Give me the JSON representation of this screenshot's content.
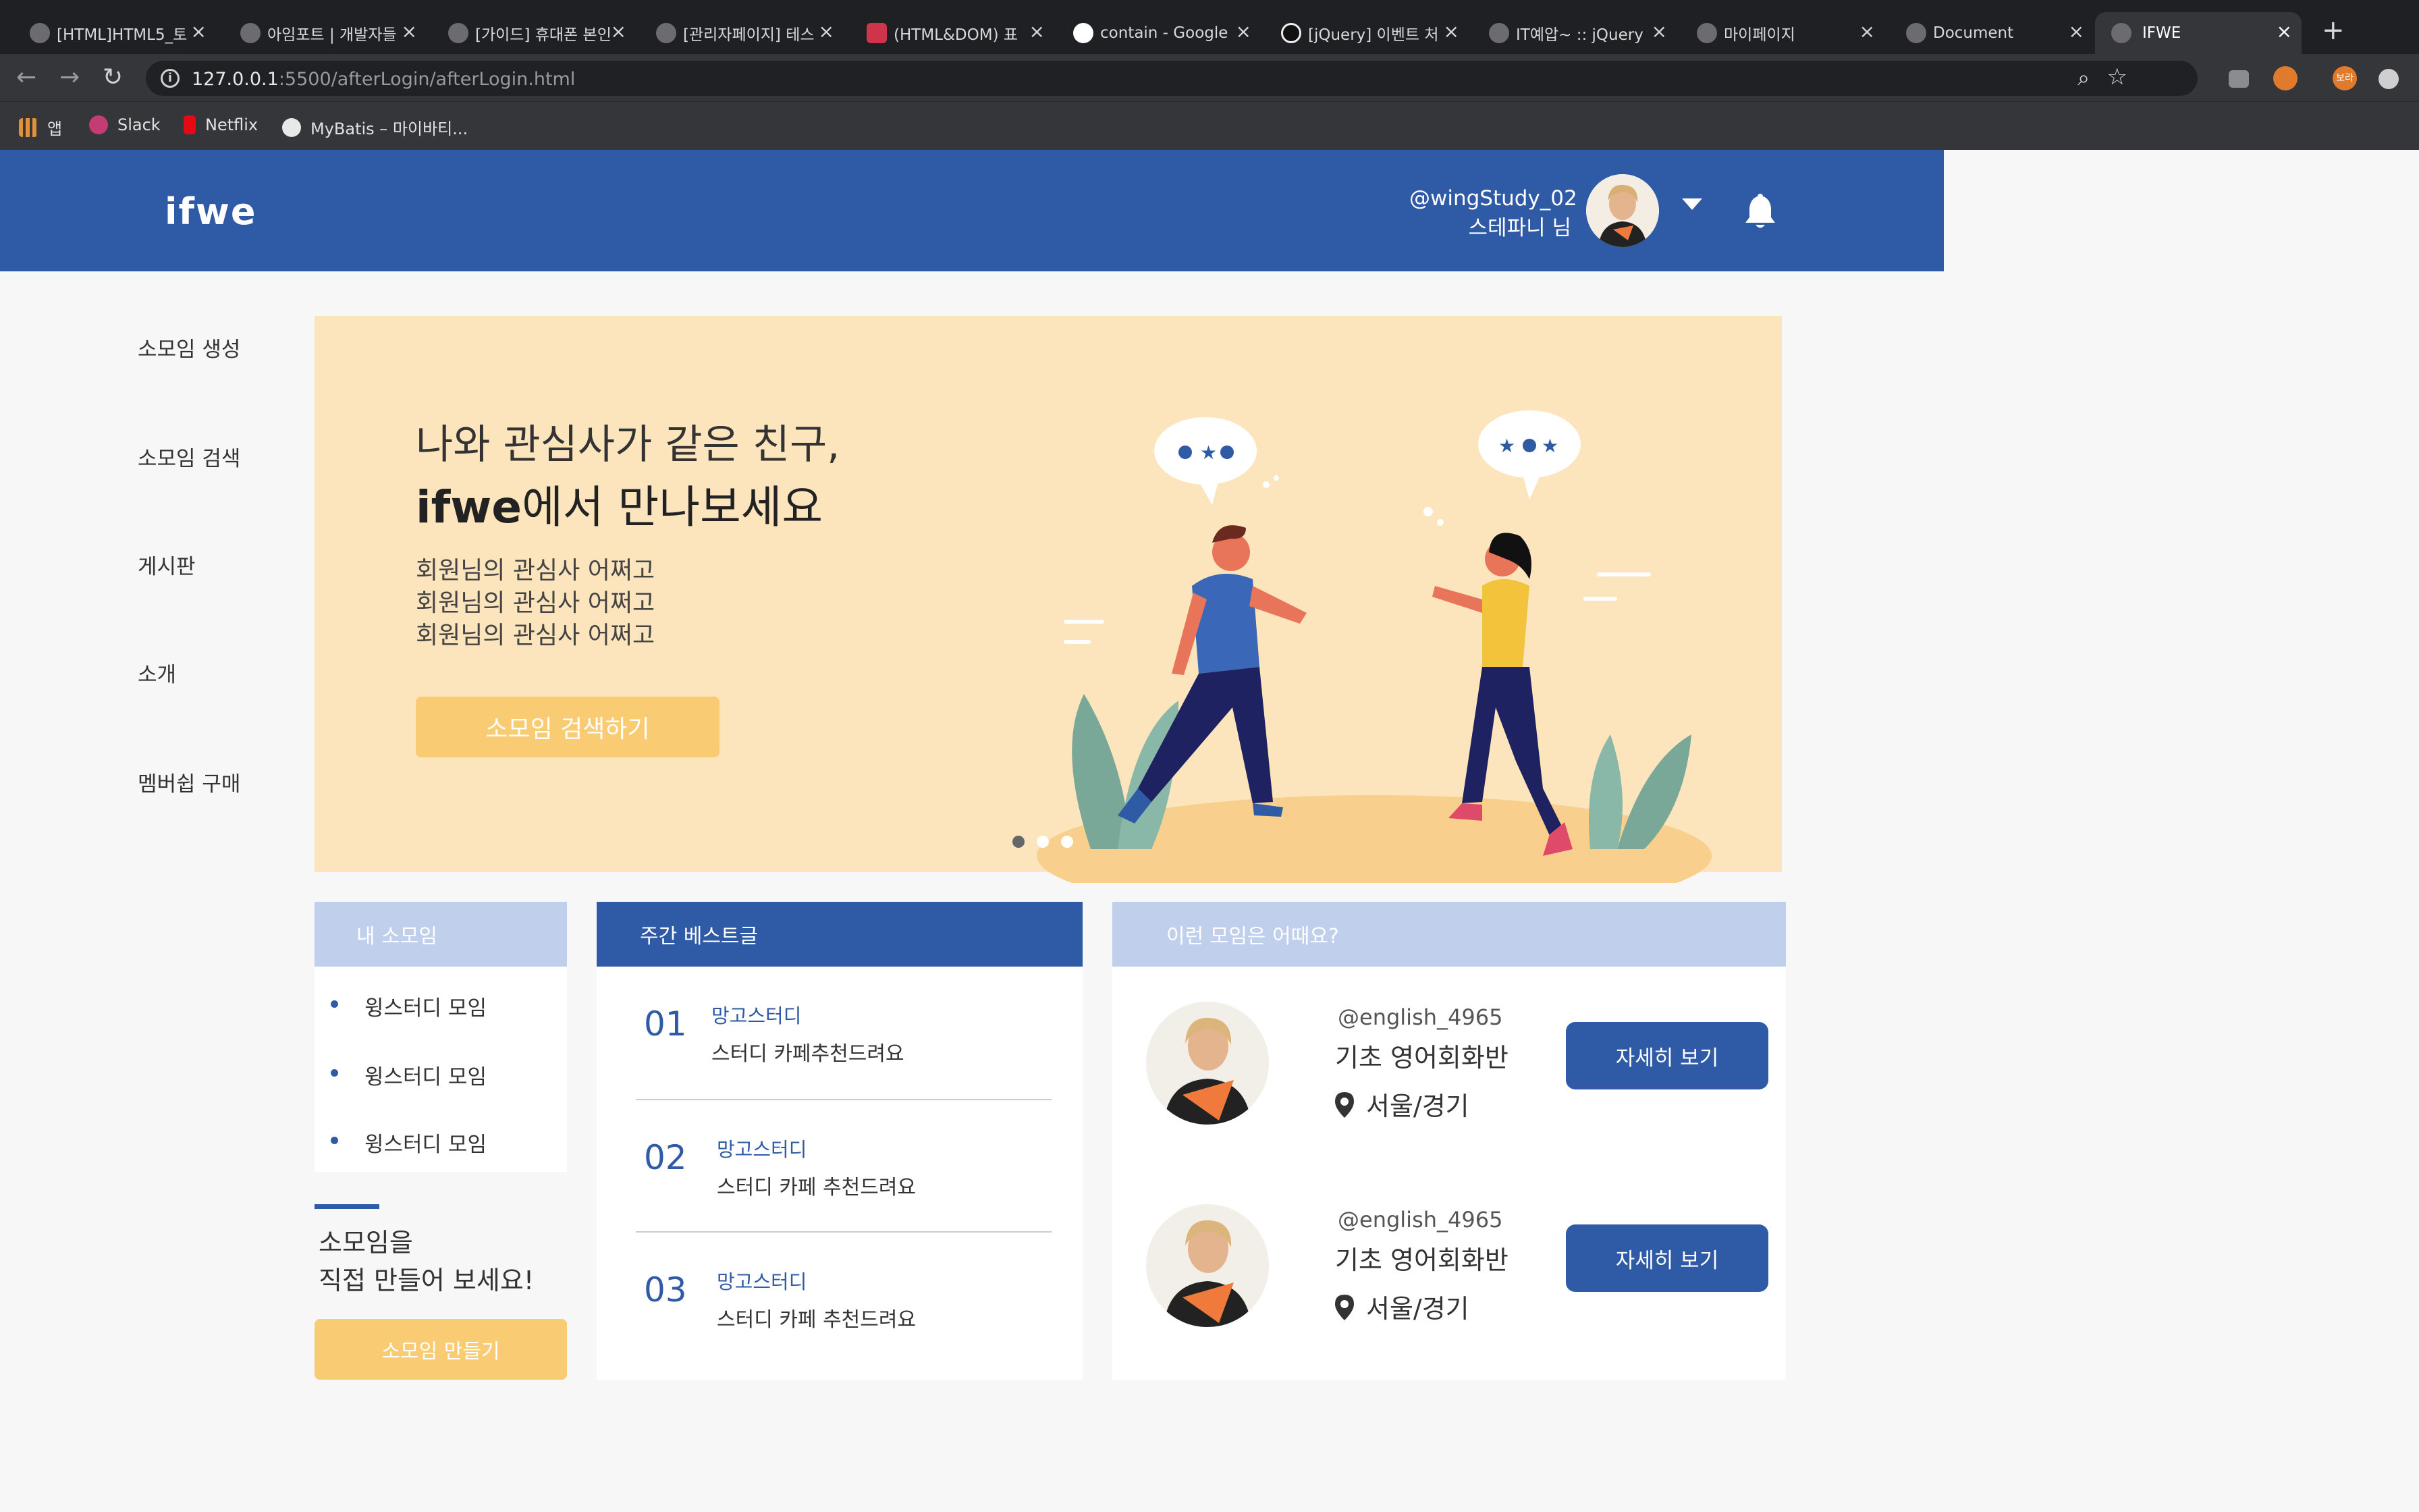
{
  "browser": {
    "tabs": [
      {
        "title": "[HTML]HTML5_토",
        "active": false
      },
      {
        "title": "아임포트 | 개발자들",
        "active": false
      },
      {
        "title": "[가이드] 휴대폰 본인",
        "active": false
      },
      {
        "title": "[관리자페이지] 테스",
        "active": false
      },
      {
        "title": "(HTML&DOM) 표",
        "active": false
      },
      {
        "title": "contain - Google",
        "active": false
      },
      {
        "title": "[jQuery] 이벤트 처",
        "active": false
      },
      {
        "title": "IT예압~ :: jQuery",
        "active": false
      },
      {
        "title": "마이페이지",
        "active": false
      },
      {
        "title": "Document",
        "active": false
      },
      {
        "title": "IFWE",
        "active": true
      }
    ],
    "url_host": "127.0.0.1",
    "url_path": ":5500/afterLogin/afterLogin.html",
    "bookmarks": [
      "앱",
      "Slack",
      "Netflix",
      "MyBatis – 마이바티..."
    ],
    "profile_label": "보라"
  },
  "header": {
    "logo": "ifwe",
    "user_id": "@wingStudy_02",
    "user_name": "스테파니 님"
  },
  "sidebar": {
    "items": [
      "소모임 생성",
      "소모임 검색",
      "게시판",
      "소개",
      "멤버쉽 구매"
    ]
  },
  "hero": {
    "line1": "나와 관심사가 같은 친구,",
    "brand": "ifwe",
    "line2_rest": "에서 만나보세요",
    "desc": [
      "회원님의 관심사 어쩌고",
      "회원님의 관심사 어쩌고",
      "회원님의 관심사 어쩌고"
    ],
    "button": "소모임 검색하기",
    "slides": 3,
    "active_slide": 0
  },
  "my_groups": {
    "title": "내 소모임",
    "items": [
      "윙스터디 모임",
      "윙스터디 모임",
      "윙스터디 모임"
    ],
    "create_line1": "소모임을",
    "create_line2": "직접 만들어 보세요!",
    "create_button": "소모임 만들기"
  },
  "weekly_best": {
    "title": "주간 베스트글",
    "posts": [
      {
        "num": "01",
        "category": "망고스터디",
        "title": "스터디 카페추천드려요"
      },
      {
        "num": "02",
        "category": "망고스터디",
        "title": "스터디 카페 추천드려요"
      },
      {
        "num": "03",
        "category": "망고스터디",
        "title": "스터디 카페 추천드려요"
      }
    ]
  },
  "recommend": {
    "title": "이런 모임은 어때요?",
    "groups": [
      {
        "user": "@english_4965",
        "title": "기초 영어회화반",
        "location": "서울/경기",
        "button": "자세히 보기"
      },
      {
        "user": "@english_4965",
        "title": "기초 영어회화반",
        "location": "서울/경기",
        "button": "자세히 보기"
      }
    ]
  },
  "colors": {
    "primary": "#2f5aa6",
    "accent_yellow": "#f9cb73",
    "hero_bg": "#fce4bc",
    "light_blue": "#bfcfec"
  }
}
